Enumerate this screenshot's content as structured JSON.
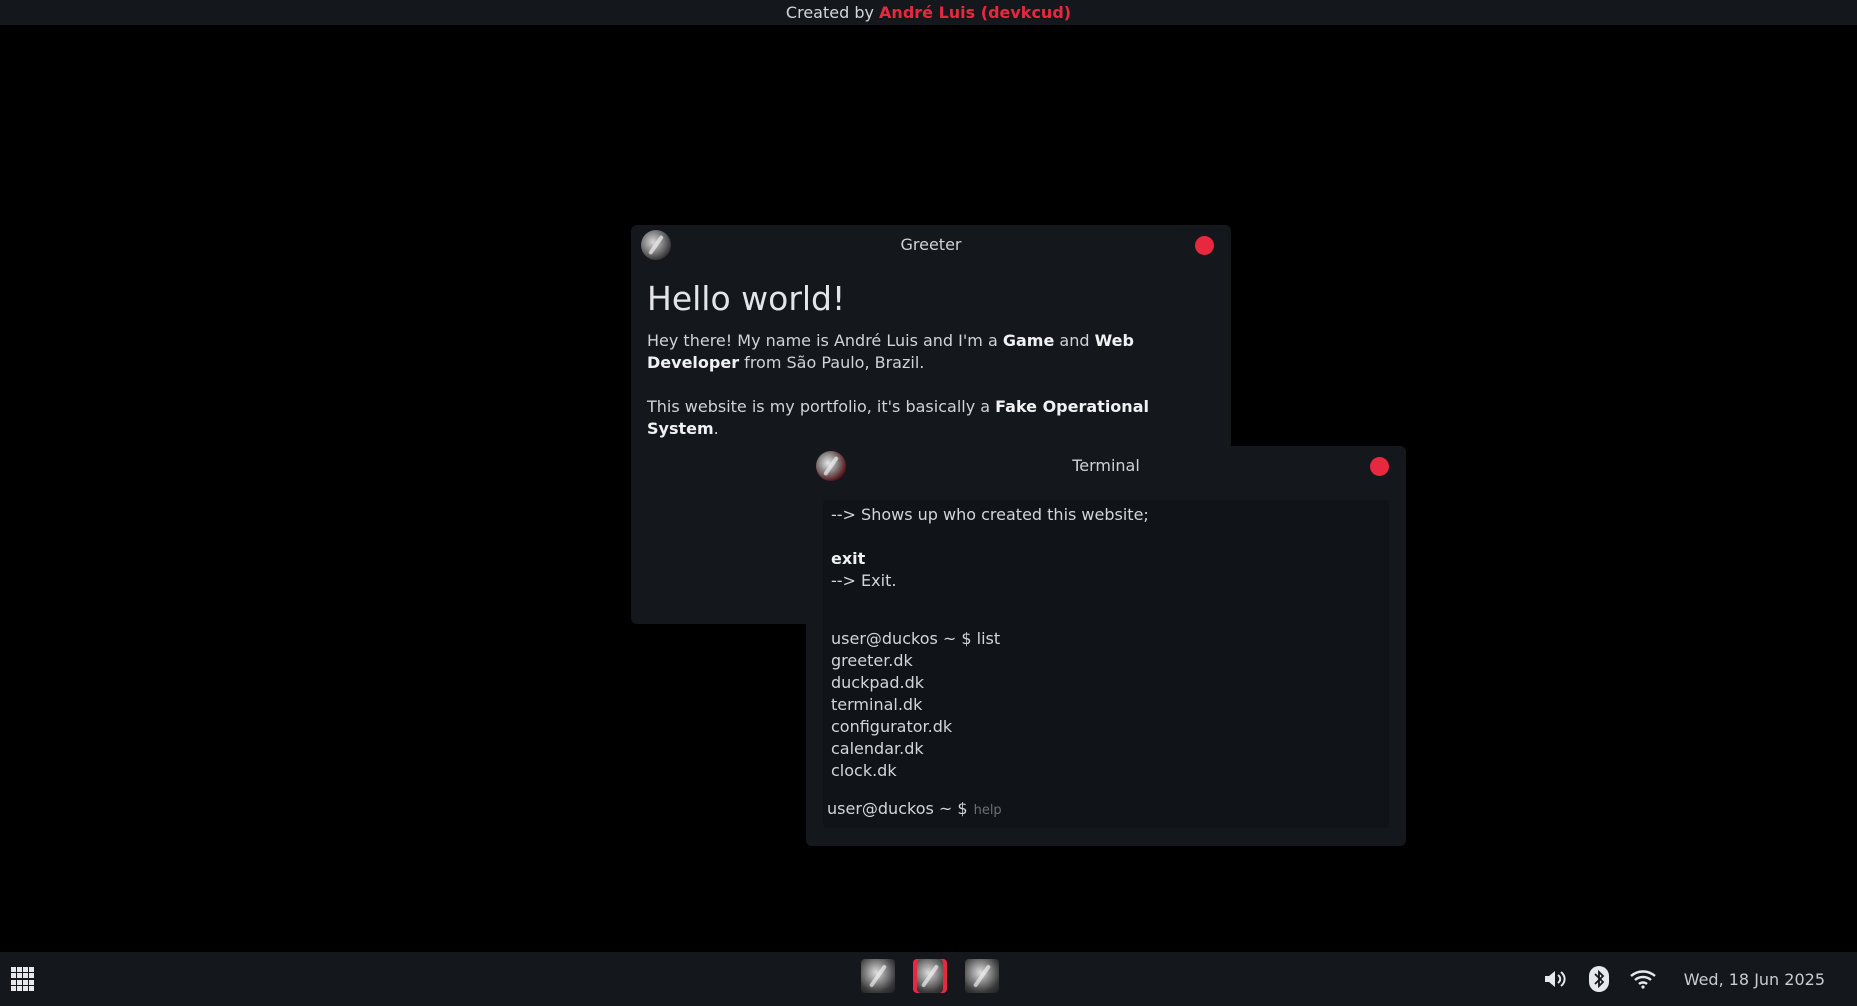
{
  "topbar": {
    "prefix": "Created by",
    "author": "André Luis (devkcud)"
  },
  "greeter": {
    "title": "Greeter",
    "heading": "Hello world!",
    "intro_prefix": "Hey there! My name is André Luis and I'm a ",
    "intro_game": "Game",
    "intro_and": " and ",
    "intro_web": "Web Developer",
    "intro_suffix": " from São Paulo, Brazil.",
    "portfolio_prefix": "This website is my portfolio, it's basically a ",
    "portfolio_fos": "Fake Operational System",
    "portfolio_suffix": "."
  },
  "terminal": {
    "title": "Terminal",
    "line_whoami_desc": "--> Shows up who created this website;",
    "cmd_exit": "exit",
    "line_exit_desc": "--> Exit.",
    "prompt_list": "user@duckos ~ $ list",
    "files": [
      "greeter.dk",
      "duckpad.dk",
      "terminal.dk",
      "configurator.dk",
      "calendar.dk",
      "clock.dk"
    ],
    "prompt": "user@duckos ~ $",
    "input_placeholder": "help"
  },
  "taskbar": {
    "date": "Wed, 18 Jun 2025",
    "apps": [
      "greeter",
      "terminal",
      "app"
    ],
    "icons": [
      "apps-grid-icon",
      "volume-icon",
      "bluetooth-icon",
      "wifi-icon"
    ]
  },
  "colors": {
    "accent": "#e8283f",
    "window_bg": "#14171c",
    "desktop_bg": "#000000"
  }
}
